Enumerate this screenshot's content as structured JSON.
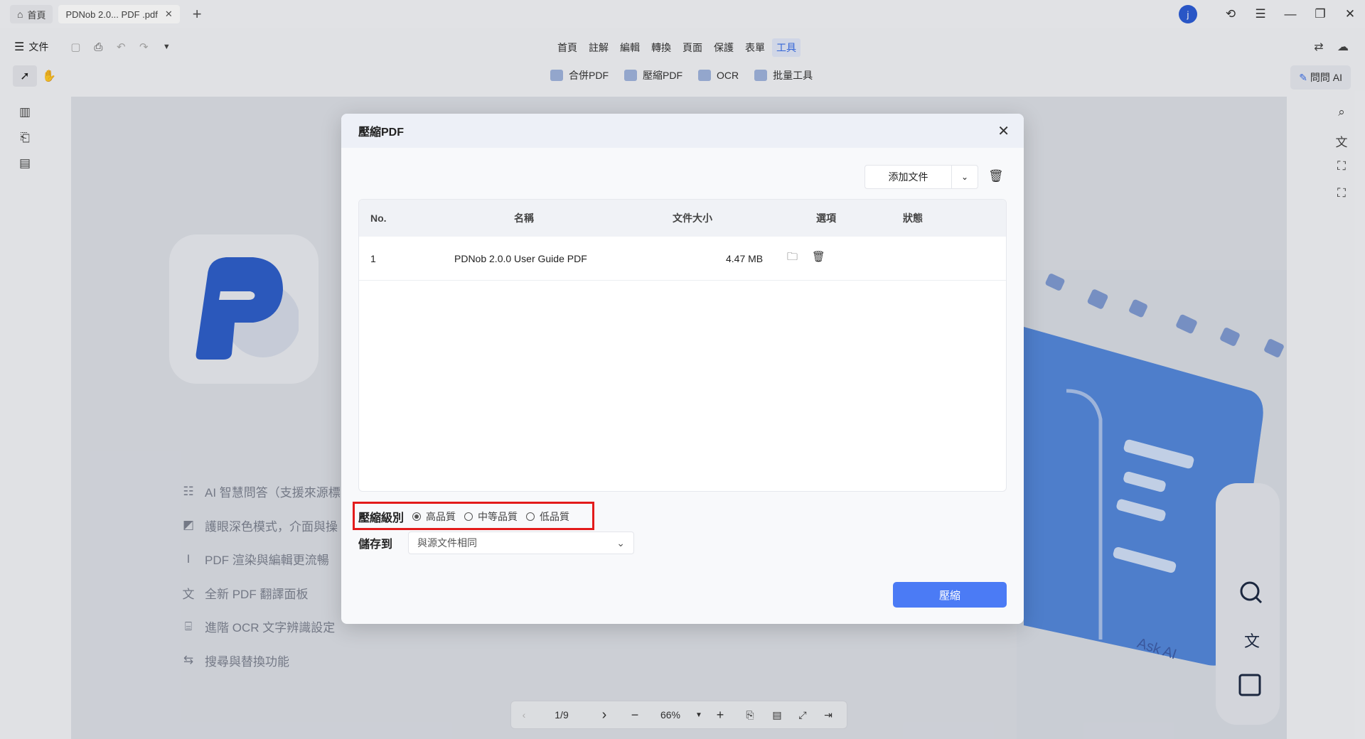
{
  "titlebar": {
    "home_tab": "首頁",
    "doc_tab": "PDNob 2.0... PDF .pdf",
    "avatar_letter": "j"
  },
  "menu": {
    "file_label": "文件",
    "tabs": [
      "首頁",
      "註解",
      "編輯",
      "轉換",
      "頁面",
      "保護",
      "表單",
      "工具"
    ],
    "selected_tab": "工具"
  },
  "toolbar": {
    "merge": "合併PDF",
    "compress": "壓縮PDF",
    "ocr": "OCR",
    "batch": "批量工具",
    "ask_ai": "問問 AI"
  },
  "features": [
    {
      "icon": "list-icon",
      "text": "AI 智慧問答（支援來源標"
    },
    {
      "icon": "eye-mode-icon",
      "text": "護眼深色模式，介面與操"
    },
    {
      "icon": "render-icon",
      "text": "PDF 渲染與編輯更流暢"
    },
    {
      "icon": "translate-icon",
      "text": "全新 PDF 翻譯面板"
    },
    {
      "icon": "ocr-icon",
      "text": "進階 OCR 文字辨識設定"
    },
    {
      "icon": "search-replace-icon",
      "text": "搜尋與替換功能"
    }
  ],
  "illustration": {
    "ask_ai": "Ask AI"
  },
  "pager": {
    "page": "1/9",
    "zoom": "66%"
  },
  "dialog": {
    "title": "壓縮PDF",
    "add_file": "添加文件",
    "table": {
      "headers": {
        "no": "No.",
        "name": "名稱",
        "size": "文件大小",
        "options": "選項",
        "status": "狀態"
      },
      "rows": [
        {
          "no": "1",
          "name": "PDNob 2.0.0 User Guide PDF",
          "size": "4.47 MB",
          "status": ""
        }
      ]
    },
    "compress_level": {
      "label": "壓縮級別",
      "options": [
        "高品質",
        "中等品質",
        "低品質"
      ],
      "selected": "高品質"
    },
    "save_to": {
      "label": "儲存到",
      "value": "與源文件相同"
    },
    "submit": "壓縮"
  },
  "colors": {
    "accent": "#4b7bf5",
    "highlight_box": "#e31b1b",
    "avatar": "#2d5dd6"
  }
}
